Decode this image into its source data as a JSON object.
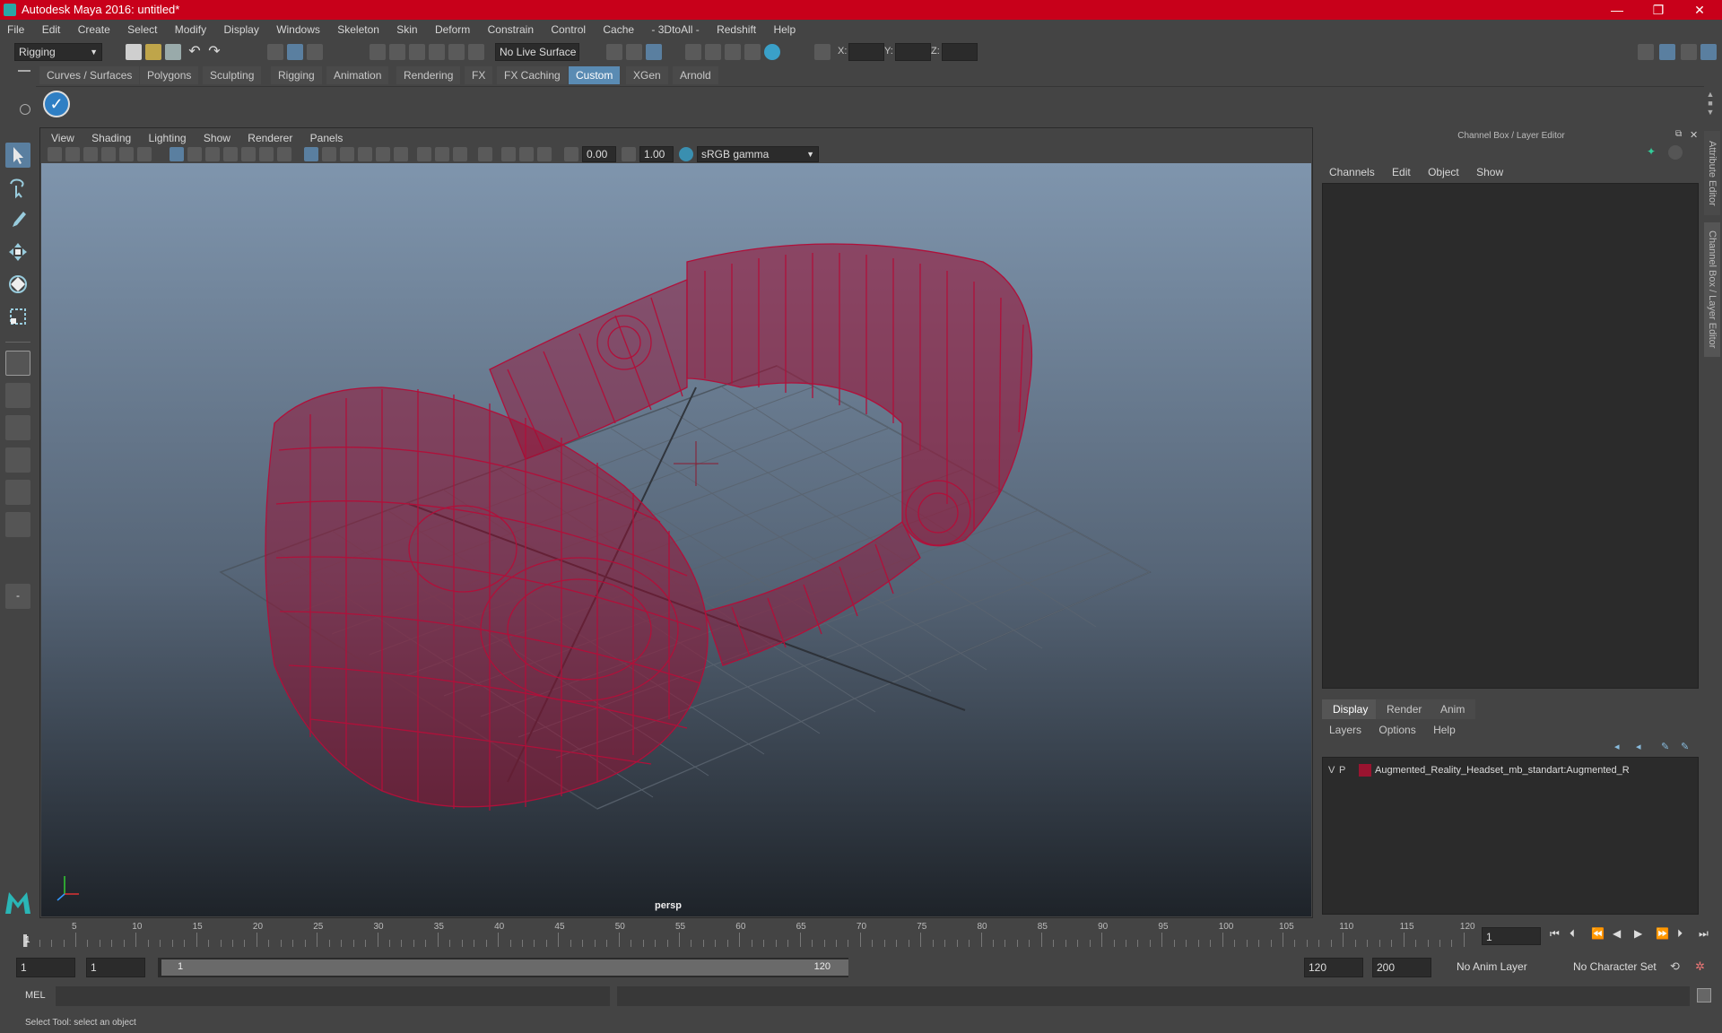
{
  "titlebar": {
    "title": "Autodesk Maya 2016: untitled*",
    "minimize": "—",
    "restore": "❐",
    "close": "✕"
  },
  "menubar": [
    "File",
    "Edit",
    "Create",
    "Select",
    "Modify",
    "Display",
    "Windows",
    "Skeleton",
    "Skin",
    "Deform",
    "Constrain",
    "Control",
    "Cache",
    "- 3DtoAll -",
    "Redshift",
    "Help"
  ],
  "statusline": {
    "menuset": "Rigging",
    "live_surface": "No Live Surface",
    "x_label": "X:",
    "y_label": "Y:",
    "z_label": "Z:"
  },
  "shelf": {
    "tabs": [
      "Curves / Surfaces",
      "Polygons",
      "Sculpting",
      "Rigging",
      "Animation",
      "Rendering",
      "FX",
      "FX Caching",
      "Custom",
      "XGen",
      "Arnold"
    ],
    "active_tab": "Custom"
  },
  "viewport": {
    "menu": [
      "View",
      "Shading",
      "Lighting",
      "Show",
      "Renderer",
      "Panels"
    ],
    "exposure": "0.00",
    "gamma": "1.00",
    "color_space": "sRGB gamma",
    "camera_label": "persp",
    "wire_color": "#b0103a"
  },
  "channelbox": {
    "title": "Channel Box / Layer Editor",
    "menu": [
      "Channels",
      "Edit",
      "Object",
      "Show"
    ]
  },
  "layereditor": {
    "tabs": [
      "Display",
      "Render",
      "Anim"
    ],
    "active_tab": "Display",
    "menu": [
      "Layers",
      "Options",
      "Help"
    ],
    "layer": {
      "v": "V",
      "p": "P",
      "name": "Augmented_Reality_Headset_mb_standart:Augmented_R",
      "color": "#9a1430"
    }
  },
  "side_tabs": {
    "attribute_editor": "Attribute Editor",
    "channel_box": "Channel Box / Layer Editor"
  },
  "timeline": {
    "ticks": [
      "5",
      "10",
      "15",
      "20",
      "25",
      "30",
      "35",
      "40",
      "45",
      "50",
      "55",
      "60",
      "65",
      "70",
      "75",
      "80",
      "85",
      "90",
      "95",
      "100",
      "105",
      "110",
      "115",
      "120"
    ],
    "current_frame_marker": "1",
    "current_frame_field": "1"
  },
  "range": {
    "start": "1",
    "playback_start": "1",
    "slider_start": "1",
    "slider_end": "120",
    "playback_end": "120",
    "end": "200",
    "anim_layer": "No Anim Layer",
    "character_set": "No Character Set"
  },
  "cmdline": {
    "label": "MEL"
  },
  "helpline": {
    "text": "Select Tool: select an object"
  }
}
